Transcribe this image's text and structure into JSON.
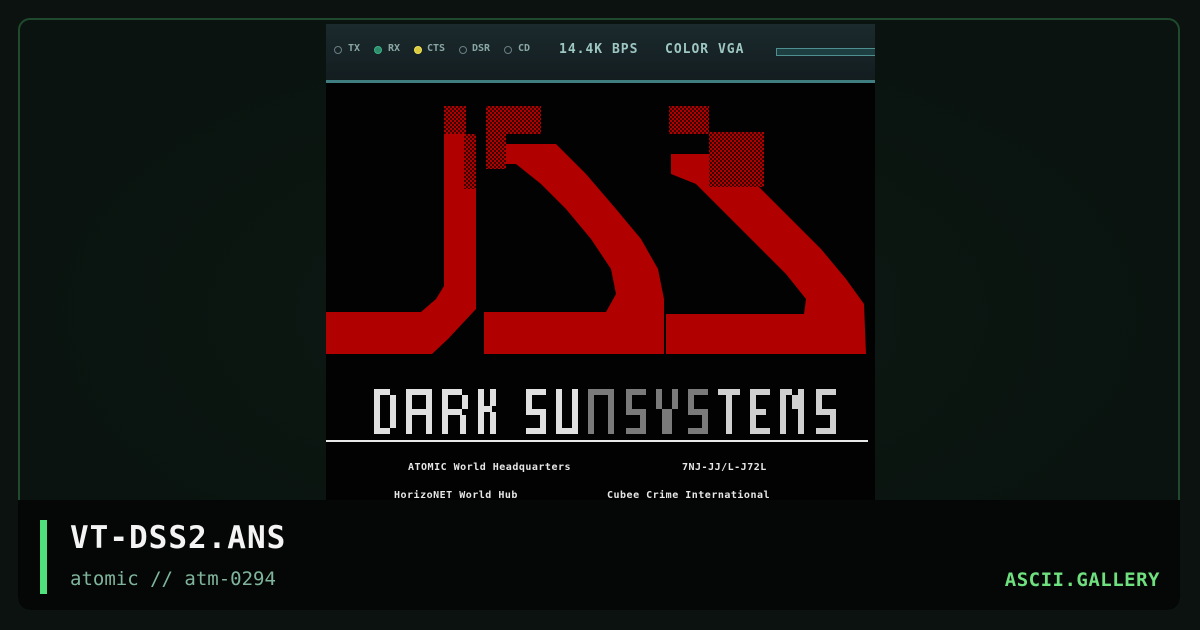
{
  "modem": {
    "leds": [
      {
        "label": "TX",
        "state": "off"
      },
      {
        "label": "RX",
        "state": "on"
      },
      {
        "label": "CTS",
        "state": "on"
      },
      {
        "label": "DSR",
        "state": "off"
      },
      {
        "label": "CD",
        "state": "off"
      }
    ],
    "speed": "14.4K BPS",
    "color_mode": "COLOR VGA"
  },
  "artwork": {
    "line1_left": "ATOMIC World Headquarters",
    "line1_right": "7NJ-JJ/L-J72L",
    "line2_left": "HorizoNET World Hub",
    "line2_right": "Cubee Crime International"
  },
  "caption": {
    "title": "VT-DSS2.ANS",
    "subtitle": "atomic // atm-0294",
    "brand": "ASCII.GALLERY"
  },
  "colors": {
    "accent": "#4fe27c",
    "art_red": "#b00000",
    "frame_border": "#1f4a2e"
  }
}
